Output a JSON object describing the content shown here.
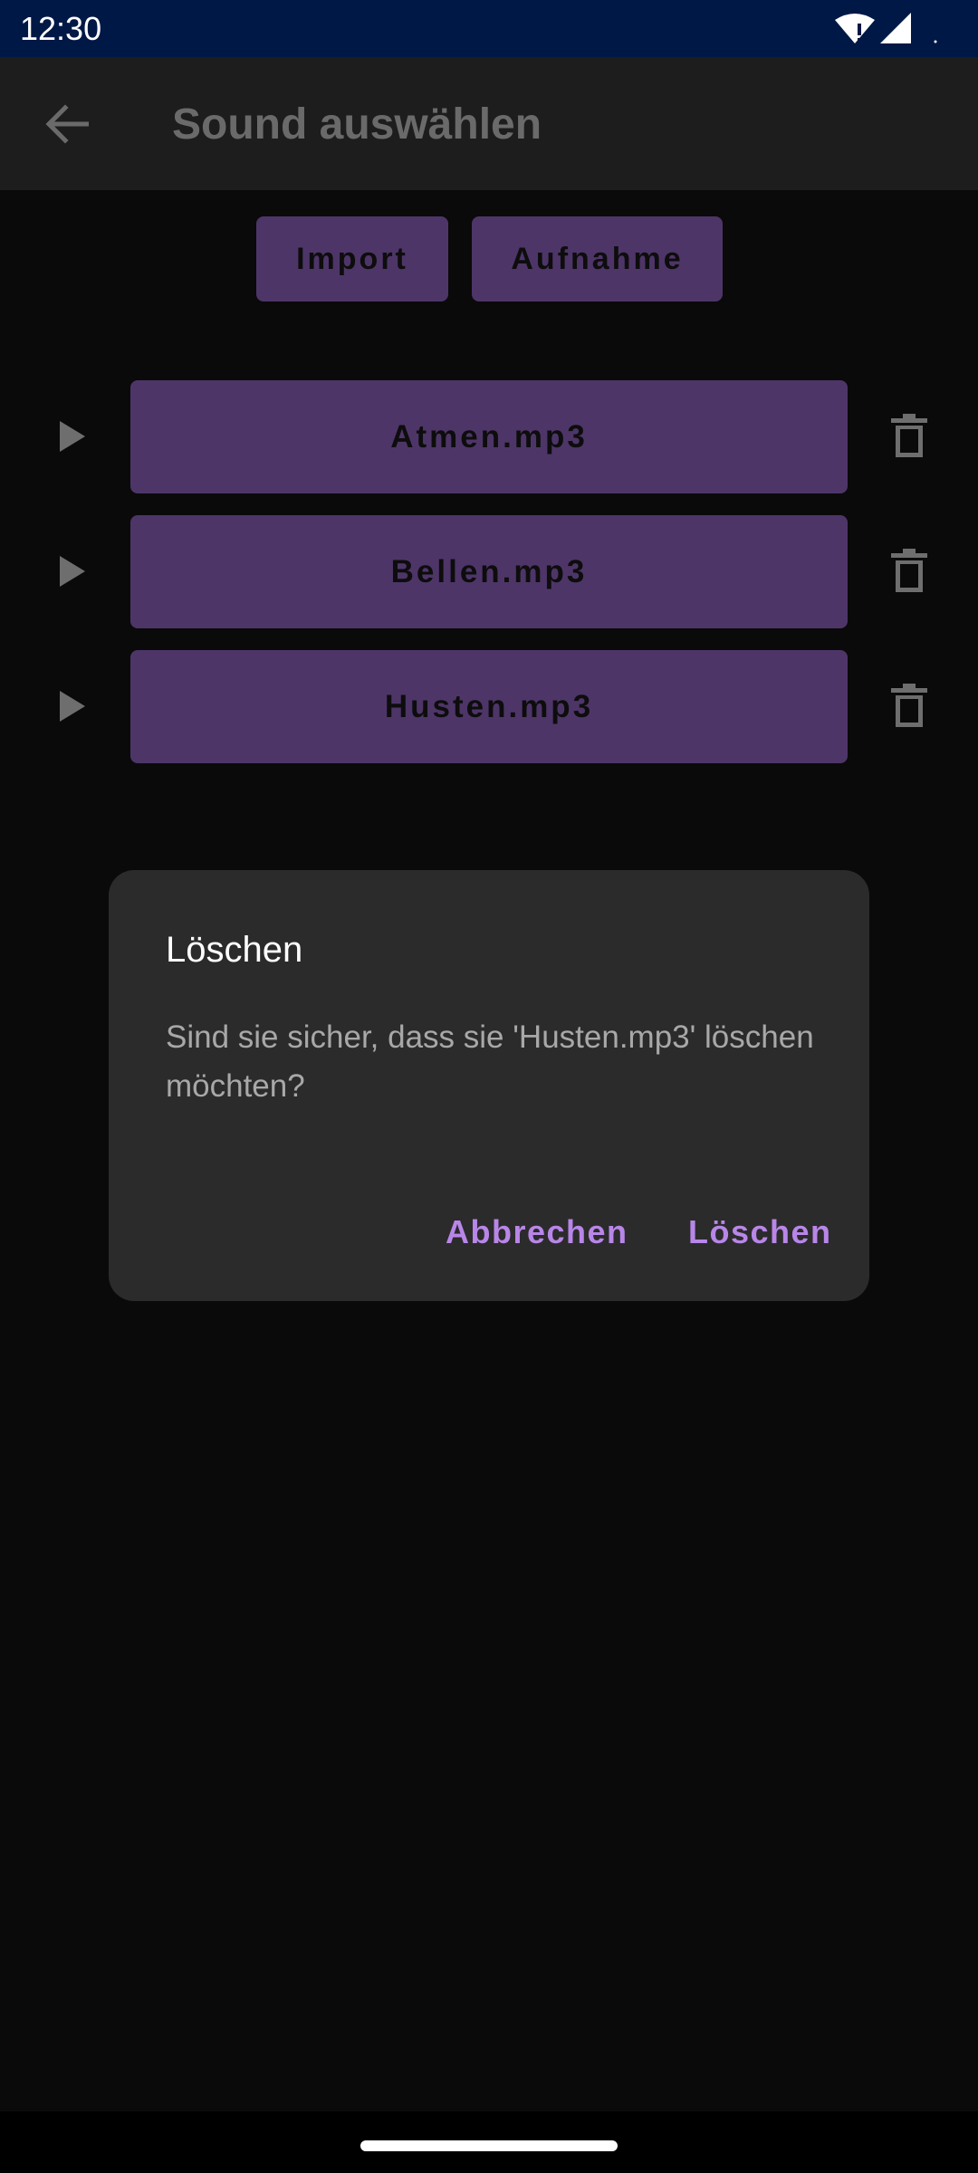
{
  "status_bar": {
    "time": "12:30",
    "icons": [
      "wifi-alert-icon",
      "cellular-signal-icon"
    ]
  },
  "app_bar": {
    "title": "Sound auswählen",
    "back_icon": "arrow-back-icon"
  },
  "actions": {
    "import_label": "Import",
    "record_label": "Aufnahme"
  },
  "sounds": [
    {
      "name": "Atmen.mp3"
    },
    {
      "name": "Bellen.mp3"
    },
    {
      "name": "Husten.mp3"
    }
  ],
  "dialog": {
    "title": "Löschen",
    "message": "Sind sie sicher, dass sie 'Husten.mp3' löschen möchten?",
    "cancel_label": "Abbrechen",
    "confirm_label": "Löschen"
  },
  "colors": {
    "accent": "#b886e8",
    "button_fill": "#4e3568",
    "status_bar": "#001845"
  }
}
